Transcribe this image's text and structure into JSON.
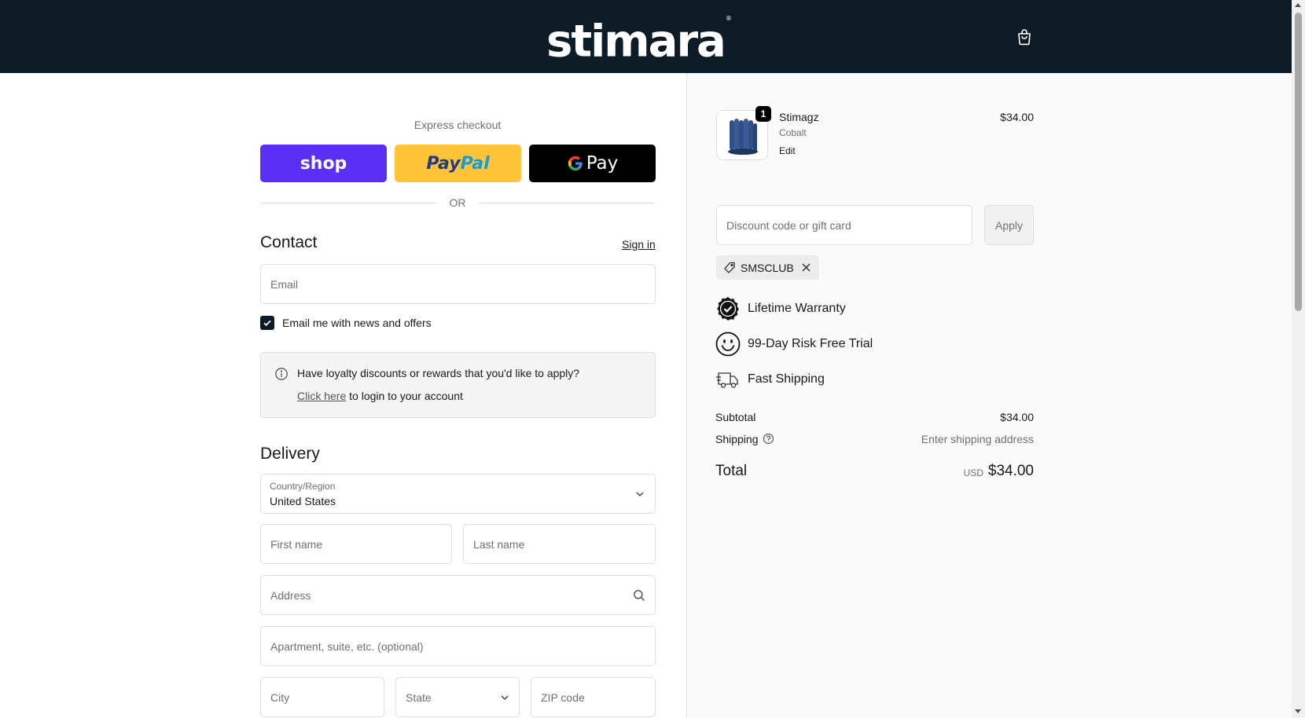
{
  "header": {
    "logo": "stimara",
    "logo_mark": "®"
  },
  "express": {
    "label": "Express checkout",
    "shop_label": "shop",
    "paypal_part1": "Pay",
    "paypal_part2": "Pal",
    "gpay_g": "G",
    "gpay_label": "Pay",
    "or_label": "OR"
  },
  "contact": {
    "title": "Contact",
    "sign_in": "Sign in",
    "email_placeholder": "Email",
    "news_label": "Email me with news and offers",
    "news_checked": true
  },
  "loyalty": {
    "question": "Have loyalty discounts or rewards that you'd like to apply?",
    "link": "Click here",
    "rest": " to login to your account"
  },
  "delivery": {
    "title": "Delivery",
    "country_label": "Country/Region",
    "country_value": "United States",
    "first_name": "First name",
    "last_name": "Last name",
    "address": "Address",
    "apartment": "Apartment, suite, etc. (optional)",
    "city": "City",
    "state": "State",
    "zip": "ZIP code"
  },
  "order": {
    "product_name": "Stimagz",
    "variant": "Cobalt",
    "edit": "Edit",
    "quantity": "1",
    "price": "$34.00",
    "discount_placeholder": "Discount code or gift card",
    "apply": "Apply",
    "applied_code": "SMSCLUB",
    "perks": [
      "Lifetime Warranty",
      "99-Day Risk Free Trial",
      "Fast Shipping"
    ],
    "subtotal_label": "Subtotal",
    "subtotal_value": "$34.00",
    "shipping_label": "Shipping",
    "shipping_value": "Enter shipping address",
    "total_label": "Total",
    "currency": "USD",
    "total_value": "$34.00"
  },
  "colors": {
    "header_bg": "#0d1b26",
    "shop_purple": "#5a31f4",
    "paypal_yellow": "#ffc439",
    "gpay_black": "#000000",
    "product_blue": "#2f4f86"
  }
}
